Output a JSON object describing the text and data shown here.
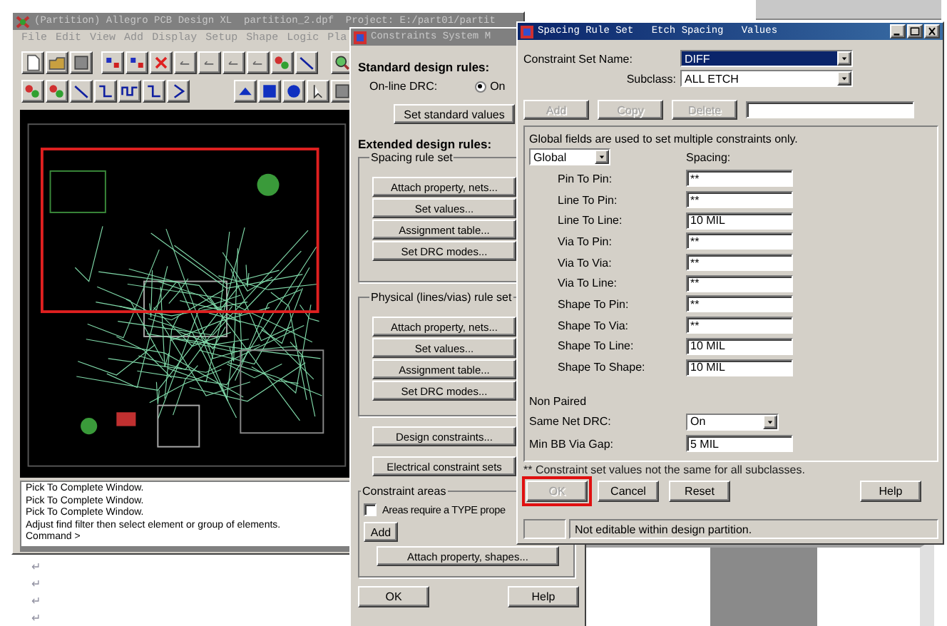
{
  "main_window": {
    "title": "(Partition) Allegro PCB Design XL  partition_2.dpf  Project: E:/part01/partit",
    "menu": [
      "File",
      "Edit",
      "View",
      "Add",
      "Display",
      "Setup",
      "Shape",
      "Logic",
      "Pla"
    ],
    "console_lines": [
      "Pick To Complete Window.",
      "Pick To Complete Window.",
      "Pick To Complete Window.",
      "Adjust find filter then select element or group of elements.",
      "Command >"
    ]
  },
  "paragraph_marks": [
    "↵",
    "↵",
    "↵",
    "↵"
  ],
  "constraints_window": {
    "title": "Constraints System M",
    "standard_heading": "Standard design rules:",
    "drc_label": "On-line DRC:",
    "drc_option": {
      "label": "On",
      "selected": true
    },
    "set_standard_button": "Set standard values",
    "extended_heading": "Extended design rules:",
    "groups": [
      {
        "title": "Spacing rule set",
        "buttons": [
          "Attach property, nets...",
          "Set values...",
          "Assignment table...",
          "Set DRC modes..."
        ]
      },
      {
        "title": "Physical (lines/vias) rule set",
        "buttons": [
          "Attach property, nets...",
          "Set values...",
          "Assignment table...",
          "Set DRC modes..."
        ]
      }
    ],
    "buttons": [
      "Design constraints...",
      "Electrical constraint sets"
    ],
    "areas": {
      "title": "Constraint areas",
      "checkbox": {
        "label": "Areas require a TYPE prope",
        "checked": false
      },
      "add_button": "Add",
      "attach_button": "Attach property, shapes..."
    },
    "footer_buttons": [
      "OK",
      "Help"
    ]
  },
  "spacing_window": {
    "title": [
      "Spacing Rule Set",
      "Etch Spacing",
      "Values"
    ],
    "set_name_label": "Constraint Set Name:",
    "set_name": {
      "value": "DIFF",
      "highlighted": true
    },
    "subclass_label": "Subclass:",
    "subclass": {
      "value": "ALL ETCH",
      "highlighted": false
    },
    "edit_buttons": [
      {
        "label": "Add",
        "disabled": true
      },
      {
        "label": "Copy",
        "disabled": true
      },
      {
        "label": "Delete",
        "disabled": true
      }
    ],
    "note": "Global fields are used to set multiple constraints only.",
    "scope": "Global",
    "column_label": "Spacing:",
    "rows": [
      {
        "label": "Pin To Pin:",
        "value": "**"
      },
      {
        "label": "Line To Pin:",
        "value": "**"
      },
      {
        "label": "Line To Line:",
        "value": "10 MIL"
      },
      {
        "label": "Via To Pin:",
        "value": "**"
      },
      {
        "label": "Via To Via:",
        "value": "**"
      },
      {
        "label": "Via To Line:",
        "value": "**"
      },
      {
        "label": "Shape To Pin:",
        "value": "**"
      },
      {
        "label": "Shape To Via:",
        "value": "**"
      },
      {
        "label": "Shape To Line:",
        "value": "10 MIL"
      },
      {
        "label": "Shape To Shape:",
        "value": "10 MIL"
      }
    ],
    "non_paired": "Non Paired",
    "same_net_label": "Same Net DRC:",
    "same_net": "On",
    "via_gap_label": "Min BB Via Gap:",
    "via_gap": "5 MIL",
    "footnote": "** Constraint set values not the same for all subclasses.",
    "buttons": [
      {
        "label": "OK",
        "disabled": true,
        "annotated": true
      },
      {
        "label": "Cancel",
        "disabled": false,
        "annotated": false
      },
      {
        "label": "Reset",
        "disabled": false,
        "annotated": false
      },
      {
        "label": "Help",
        "disabled": false,
        "annotated": false
      }
    ],
    "status": "Not editable within design partition."
  }
}
